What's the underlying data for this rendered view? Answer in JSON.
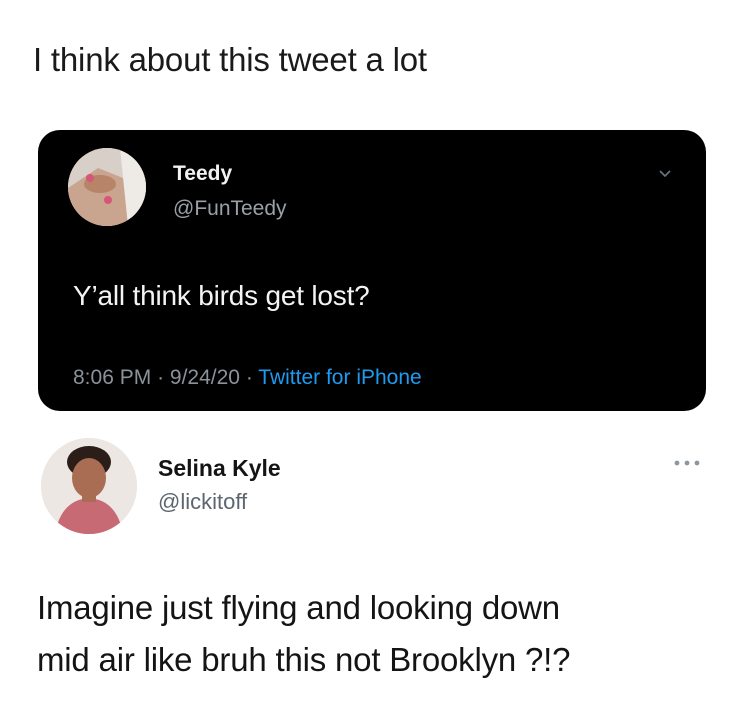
{
  "caption": "I think about this tweet a lot",
  "original_tweet": {
    "author_name": "Teedy",
    "author_handle": "@FunTeedy",
    "text": "Y’all think birds get lost?",
    "time": "8:06 PM",
    "date": "9/24/20",
    "source": "Twitter for iPhone",
    "separator": "·"
  },
  "reply_tweet": {
    "author_name": "Selina Kyle",
    "author_handle": "@lickitoff",
    "text_lines": [
      "Imagine just flying and looking down",
      "mid air like bruh this not Brooklyn ?!?"
    ]
  },
  "colors": {
    "dark_card": "#000000",
    "link_blue": "#1d9bf0",
    "muted_gray": "#8b9299"
  },
  "icons": [
    "chevron-down-icon",
    "more-options-icon"
  ]
}
